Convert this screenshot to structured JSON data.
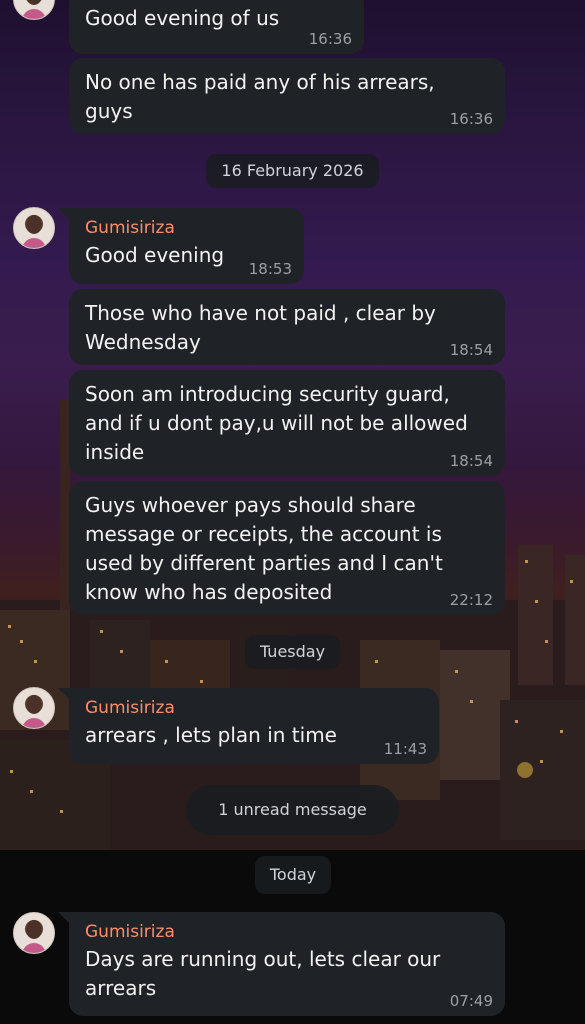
{
  "chat": {
    "messages": [
      {
        "text": "Good evening of us",
        "time": "16:36"
      },
      {
        "text": "No one has paid any of his arrears,\nguys",
        "time": "16:36"
      },
      {
        "sender": "Gumisiriza",
        "text": "Good evening",
        "time": "18:53"
      },
      {
        "text": "Those who have not paid , clear by\nWednesday",
        "time": "18:54"
      },
      {
        "text": "Soon am introducing security guard,\nand if u dont pay,u will not be allowed\ninside",
        "time": "18:54"
      },
      {
        "text": "Guys whoever pays should share\nmessage or receipts,  the account is\nused by different parties  and I can't\nknow who has deposited",
        "time": "22:12"
      },
      {
        "sender": "Gumisiriza",
        "text": "arrears , lets plan in time",
        "time": "11:43"
      },
      {
        "sender": "Gumisiriza",
        "text": "Days are running out, lets clear our\narrears",
        "time": "07:49"
      }
    ],
    "dividers": {
      "date_feb": "16 February 2026",
      "tuesday": "Tuesday",
      "unread": "1 unread message",
      "today": "Today"
    }
  },
  "colors": {
    "bubble": "#1f2327",
    "sender_name": "#ff8e64",
    "time": "#9aa0a6"
  }
}
